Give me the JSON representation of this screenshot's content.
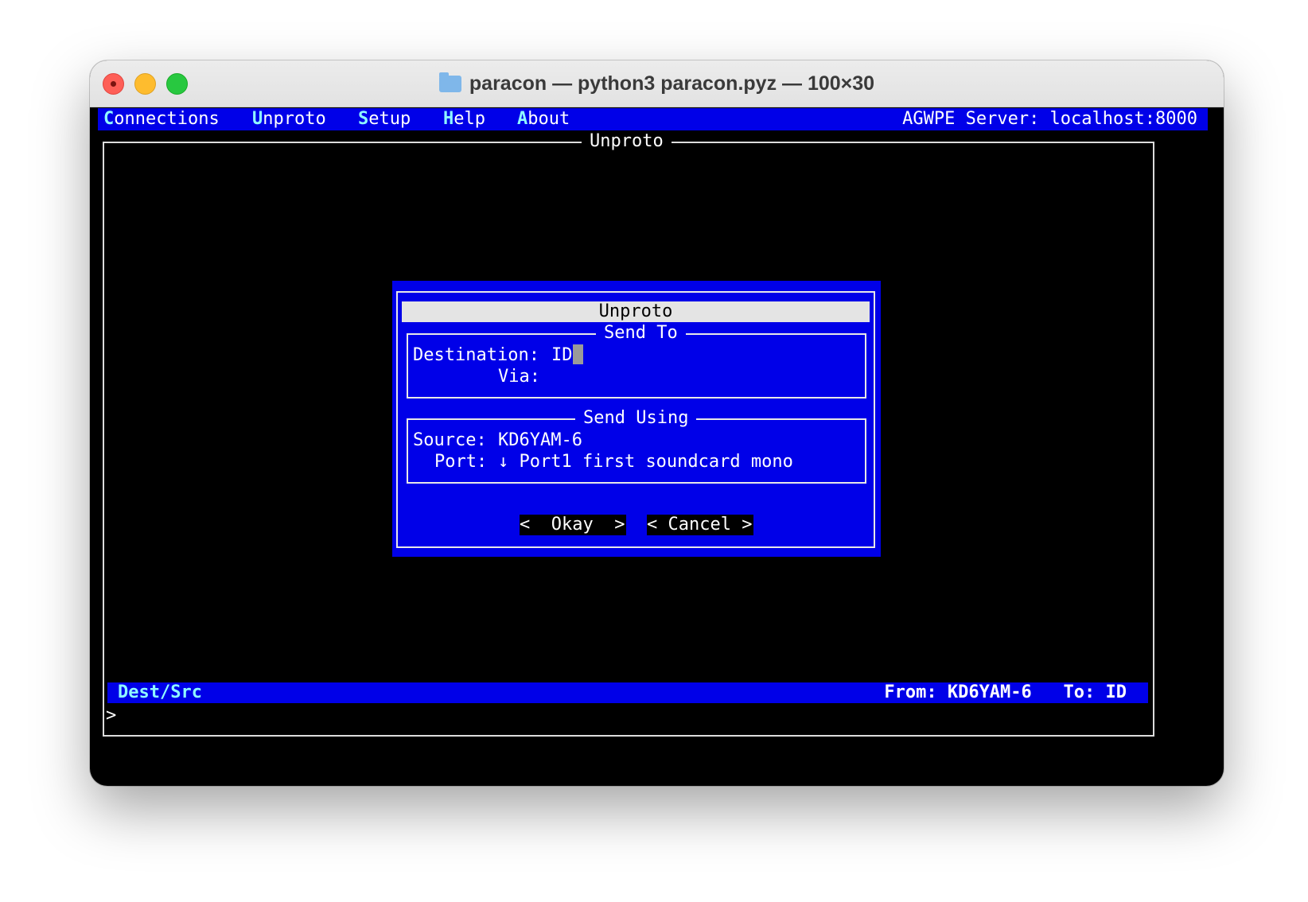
{
  "window": {
    "title": "paracon — python3 paracon.pyz — 100×30"
  },
  "menu": {
    "items": [
      {
        "hot": "C",
        "rest": "onnections"
      },
      {
        "hot": "U",
        "rest": "nproto"
      },
      {
        "hot": "S",
        "rest": "etup"
      },
      {
        "hot": "H",
        "rest": "elp"
      },
      {
        "hot": "A",
        "rest": "bout"
      }
    ],
    "server": "AGWPE Server: localhost:8000"
  },
  "main": {
    "frame_title": "Unproto",
    "prompt": ">"
  },
  "dialog": {
    "title": "Unproto",
    "send_to": {
      "title": "Send To",
      "destination_label": "Destination:",
      "destination_value": "ID",
      "via_label": "Via:",
      "via_value": ""
    },
    "send_using": {
      "title": "Send Using",
      "source_label": "Source:",
      "source_value": "KD6YAM-6",
      "port_label": "Port:",
      "port_arrow": "↓",
      "port_value": "Port1 first soundcard mono"
    },
    "buttons": {
      "okay": "<  Okay  >",
      "cancel": "< Cancel >"
    }
  },
  "statusbar": {
    "left": "Dest/Src",
    "right": "From: KD6YAM-6   To: ID"
  }
}
